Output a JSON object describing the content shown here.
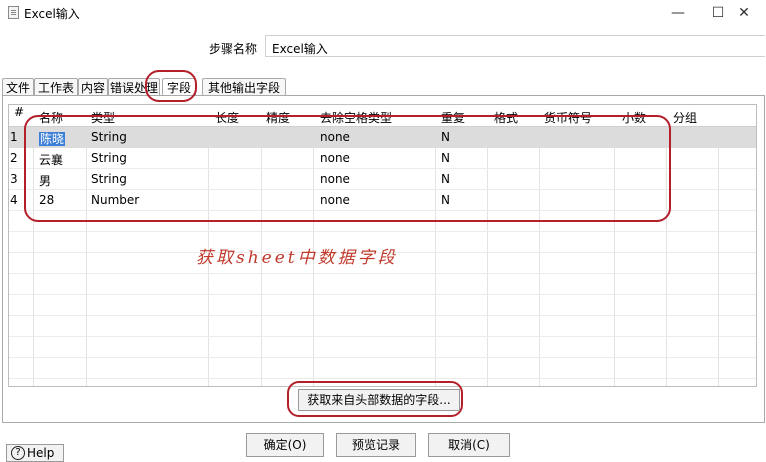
{
  "window": {
    "title": "Excel输入",
    "minimize": "—",
    "maximize": "☐",
    "close": "✕"
  },
  "step": {
    "label": "步骤名称",
    "value": "Excel输入"
  },
  "tabs": [
    {
      "label": "文件"
    },
    {
      "label": "工作表"
    },
    {
      "label": "内容"
    },
    {
      "label": "错误处理"
    },
    {
      "label": "字段",
      "active": true
    },
    {
      "label": "其他输出字段"
    }
  ],
  "table": {
    "columns": [
      "#",
      "名称",
      "类型",
      "长度",
      "精度",
      "去除空格类型",
      "重复",
      "格式",
      "货币符号",
      "小数",
      "分组"
    ],
    "rows": [
      {
        "num": "1",
        "name": "陈晓",
        "type": "String",
        "trim": "none",
        "repeat": "N"
      },
      {
        "num": "2",
        "name": "云襄",
        "type": "String",
        "trim": "none",
        "repeat": "N"
      },
      {
        "num": "3",
        "name": "男",
        "type": "String",
        "trim": "none",
        "repeat": "N"
      },
      {
        "num": "4",
        "name": "28",
        "type": "Number",
        "trim": "none",
        "repeat": "N"
      }
    ]
  },
  "annotation": "获取sheet中数据字段",
  "buttons": {
    "get_fields": "获取来自头部数据的字段...",
    "ok": "确定(O)",
    "preview": "预览记录",
    "cancel": "取消(C)",
    "help": "Help"
  },
  "colors": {
    "annotation_red": "#b3202a",
    "selection_blue": "#3b7fd6"
  }
}
